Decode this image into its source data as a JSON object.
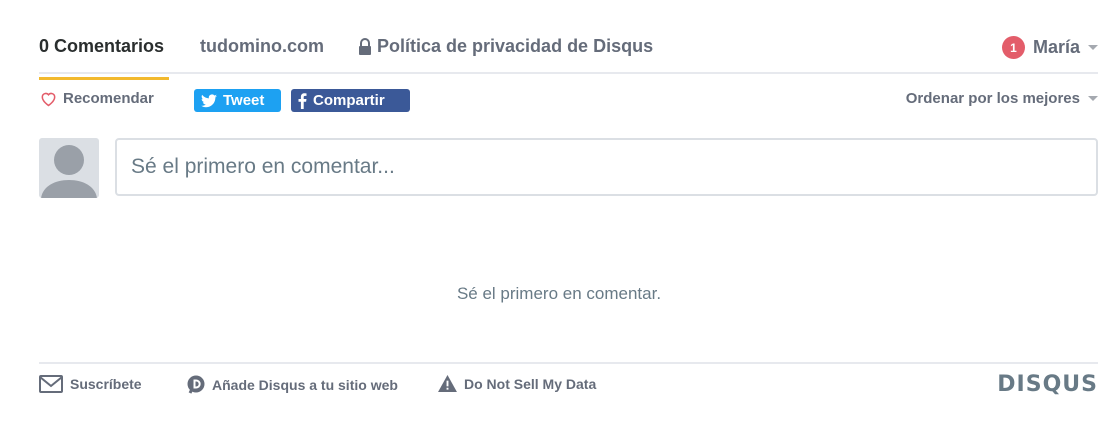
{
  "nav": {
    "comments_tab": "0 Comentarios",
    "site_tab": "tudomino.com",
    "privacy_tab": "Política de privacidad de Disqus",
    "user_name": "María",
    "notification_count": "1"
  },
  "actions": {
    "recommend": "Recomendar",
    "tweet": "Tweet",
    "share": "Compartir",
    "sort": "Ordenar por los mejores"
  },
  "composer": {
    "placeholder": "Sé el primero en comentar..."
  },
  "empty_message": "Sé el primero en comentar.",
  "footer": {
    "subscribe": "Suscríbete",
    "add_disqus": "Añade Disqus a tu sitio web",
    "do_not_sell": "Do Not Sell My Data",
    "logo": "DISQUS"
  },
  "colors": {
    "accent_underline": "#f2b92e",
    "twitter": "#1da1f2",
    "facebook": "#3b5998",
    "badge": "#e35d6a"
  },
  "icons": [
    "heart-icon",
    "twitter-icon",
    "facebook-icon",
    "lock-icon",
    "caret-down-icon",
    "envelope-icon",
    "disqus-d-icon",
    "warning-icon",
    "avatar-placeholder"
  ]
}
